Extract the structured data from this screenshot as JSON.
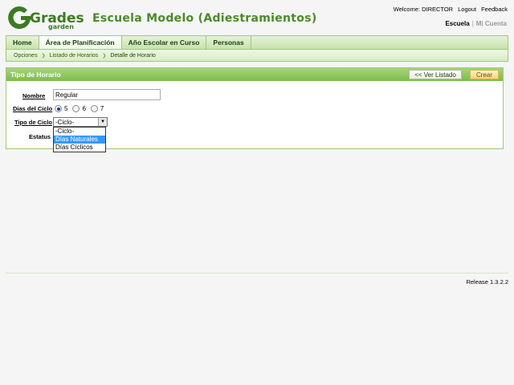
{
  "header": {
    "logo_text": "Grades",
    "logo_subtext": "garden",
    "school_title": "Escuela Modelo (Adiestramientos)",
    "welcome": "Welcome: DIRECTOR",
    "logout": "Logout",
    "feedback": "Feedback",
    "scope_active": "Escuela",
    "scope_separator": "|",
    "scope_inactive": "Mi Cuenta"
  },
  "nav": {
    "tabs": [
      {
        "label": "Home"
      },
      {
        "label": "Área de Planificación"
      },
      {
        "label": "Año Escolar en Curso"
      },
      {
        "label": "Personas"
      }
    ],
    "active_index": 1
  },
  "breadcrumb": {
    "items": [
      "Opciones",
      "Listado de Horarios"
    ],
    "current": "Detalle de Horario"
  },
  "panel": {
    "title": "Tipo de Horario",
    "list_button": "<< Ver Listado",
    "create_button": "Crear"
  },
  "form": {
    "name_label": "Nombre",
    "name_value": "Regular",
    "days_label": "Dias del Ciclo",
    "days_options": [
      "5",
      "6",
      "7"
    ],
    "days_selected": "5",
    "type_label": "Tipo de Ciclo",
    "type_value": "-Ciclo-",
    "type_options": [
      "-Ciclo-",
      "Días Naturales",
      "Días Cíclicos"
    ],
    "type_highlighted": "Días Naturales",
    "status_label": "Estatus"
  },
  "footer": {
    "release": "Release 1.3.2.2"
  },
  "colors": {
    "brand_green": "#4a8a2a",
    "panel_header": "#7cbc4a",
    "highlight": "#3399ff"
  }
}
